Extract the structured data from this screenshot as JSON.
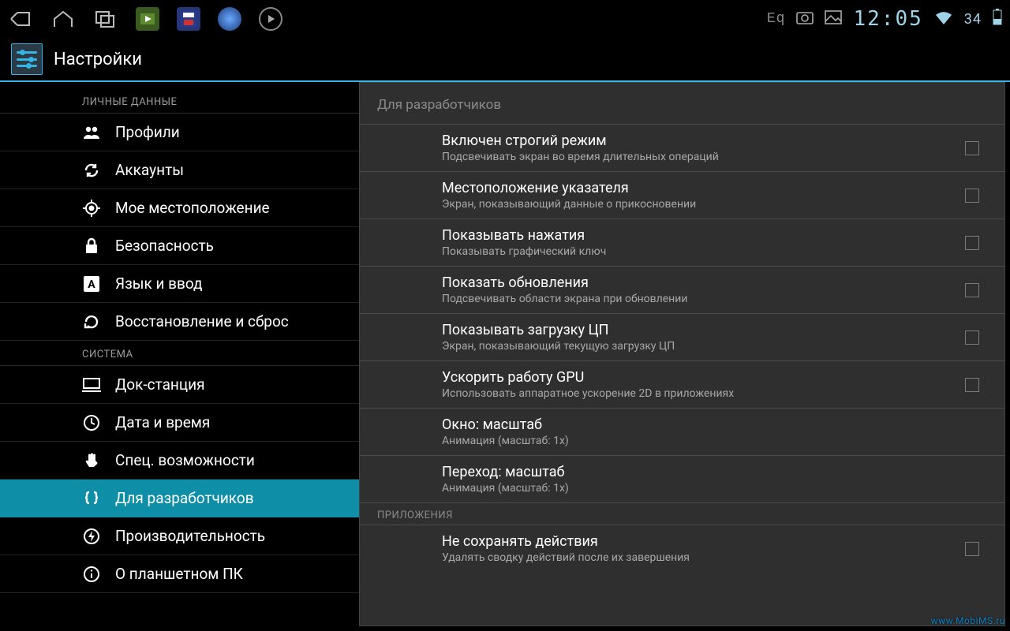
{
  "status": {
    "eq": "Eq",
    "clock": "12:05",
    "battery": "34"
  },
  "title": "Настройки",
  "sidebar": {
    "groups": [
      {
        "header": "ЛИЧНЫЕ ДАННЫЕ",
        "items": [
          {
            "icon": "profiles",
            "label": "Профили"
          },
          {
            "icon": "accounts",
            "label": "Аккаунты"
          },
          {
            "icon": "location",
            "label": "Мое местоположение"
          },
          {
            "icon": "security",
            "label": "Безопасность"
          },
          {
            "icon": "language",
            "label": "Язык и ввод"
          },
          {
            "icon": "backup",
            "label": "Восстановление и сброс"
          }
        ]
      },
      {
        "header": "СИСТЕМА",
        "items": [
          {
            "icon": "dock",
            "label": "Док-станция"
          },
          {
            "icon": "clock",
            "label": "Дата и время"
          },
          {
            "icon": "a11y",
            "label": "Спец. возможности"
          },
          {
            "icon": "dev",
            "label": "Для разработчиков",
            "selected": true
          },
          {
            "icon": "perf",
            "label": "Производительность"
          },
          {
            "icon": "about",
            "label": "О планшетном ПК"
          }
        ]
      }
    ]
  },
  "content": {
    "header": "Для разработчиков",
    "prefs": [
      {
        "title": "Включен строгий режим",
        "sub": "Подсвечивать экран во время длительных операций",
        "checkbox": true
      },
      {
        "title": "Местоположение указателя",
        "sub": "Экран, показывающий данные о прикосновении",
        "checkbox": true
      },
      {
        "title": "Показывать нажатия",
        "sub": "Показывать графический ключ",
        "checkbox": true
      },
      {
        "title": "Показать обновления",
        "sub": "Подсвечивать области экрана при обновлении",
        "checkbox": true
      },
      {
        "title": "Показывать загрузку ЦП",
        "sub": "Экран, показывающий текущую загрузку ЦП",
        "checkbox": true
      },
      {
        "title": "Ускорить работу GPU",
        "sub": "Использовать аппаратное ускорение 2D в приложениях",
        "checkbox": true
      },
      {
        "title": "Окно: масштаб",
        "sub": "Анимация (масштаб: 1x)",
        "checkbox": false
      },
      {
        "title": "Переход: масштаб",
        "sub": "Анимация (масштаб: 1x)",
        "checkbox": false
      }
    ],
    "group2_header": "ПРИЛОЖЕНИЯ",
    "prefs2": [
      {
        "title": "Не сохранять действия",
        "sub": "Удалять сводку действий после их завершения",
        "checkbox": true
      }
    ]
  },
  "watermark": "www.MobiMS.ru"
}
